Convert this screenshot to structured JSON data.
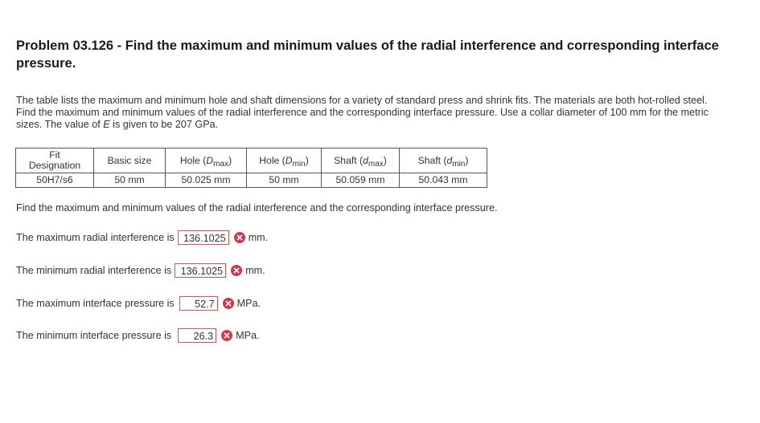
{
  "problem": {
    "title": "Problem 03.126 - Find the maximum and minimum values of the radial interference and corresponding interface pressure.",
    "description_part1": "The table lists the maximum and minimum hole and shaft dimensions for a variety of standard press and shrink fits. The materials are both hot-rolled steel. Find the maximum and minimum values of the radial interference and the corresponding interface pressure. Use a collar diameter of 100 mm for the metric sizes. The value of ",
    "description_var": "E",
    "description_part2": " is given to be 207 GPa."
  },
  "table": {
    "headers": {
      "fit_line1": "Fit",
      "fit_line2": "Designation",
      "basic_size": "Basic size",
      "hole_max_prefix": "Hole (",
      "hole_max_var": "D",
      "hole_max_sub": "max",
      "hole_max_suffix": ")",
      "hole_min_prefix": "Hole (",
      "hole_min_var": "D",
      "hole_min_sub": "min",
      "hole_min_suffix": ")",
      "shaft_max_prefix": "Shaft (",
      "shaft_max_var": "d",
      "shaft_max_sub": "max",
      "shaft_max_suffix": ")",
      "shaft_min_prefix": "Shaft (",
      "shaft_min_var": "d",
      "shaft_min_sub": "min",
      "shaft_min_suffix": ")"
    },
    "row": {
      "fit": "50H7/s6",
      "basic_size": "50 mm",
      "hole_max": "50.025 mm",
      "hole_min": "50 mm",
      "shaft_max": "50.059 mm",
      "shaft_min": "50.043 mm"
    }
  },
  "prompt": "Find the maximum and minimum values of the radial interference and the corresponding interface pressure.",
  "answers": {
    "max_interference": {
      "label": "The maximum radial interference is",
      "value": "136.1025",
      "unit": "mm."
    },
    "min_interference": {
      "label": "The minimum radial interference is",
      "value": "136.1025",
      "unit": "mm."
    },
    "max_pressure": {
      "label": "The maximum interface pressure is",
      "value": "52.7",
      "unit": "MPa."
    },
    "min_pressure": {
      "label": "The minimum interface pressure is",
      "value": "26.3",
      "unit": "MPa."
    }
  },
  "icons": {
    "incorrect": "incorrect-x-icon"
  },
  "colors": {
    "incorrect": "#d9344a",
    "answer_border": "#d9534f"
  }
}
